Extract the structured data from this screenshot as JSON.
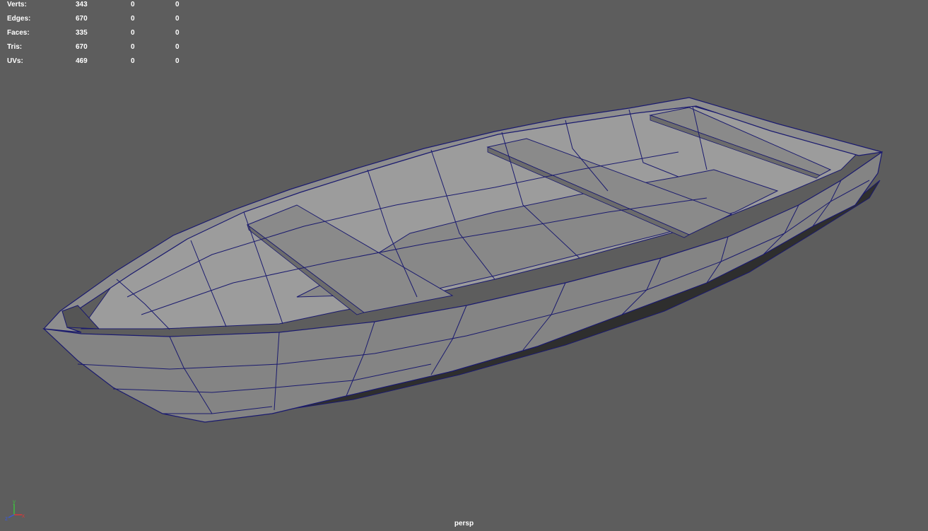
{
  "hud": {
    "rows": [
      {
        "label": "Verts:",
        "values": [
          "343",
          "0",
          "0"
        ]
      },
      {
        "label": "Edges:",
        "values": [
          "670",
          "0",
          "0"
        ]
      },
      {
        "label": "Faces:",
        "values": [
          "335",
          "0",
          "0"
        ]
      },
      {
        "label": "Tris:",
        "values": [
          "670",
          "0",
          "0"
        ]
      },
      {
        "label": "UVs:",
        "values": [
          "469",
          "0",
          "0"
        ]
      }
    ]
  },
  "camera_label": "persp",
  "axis_gizmo": {
    "y": "y",
    "x": "x",
    "z": "z"
  },
  "colors": {
    "background": "#5d5d5d",
    "wireframe": "#1a1a6e",
    "hull_light": "#9a9a9a",
    "hull_mid": "#7f7f7f",
    "hull_dark": "#3a3a3a",
    "seat": "#8a8a8a"
  }
}
